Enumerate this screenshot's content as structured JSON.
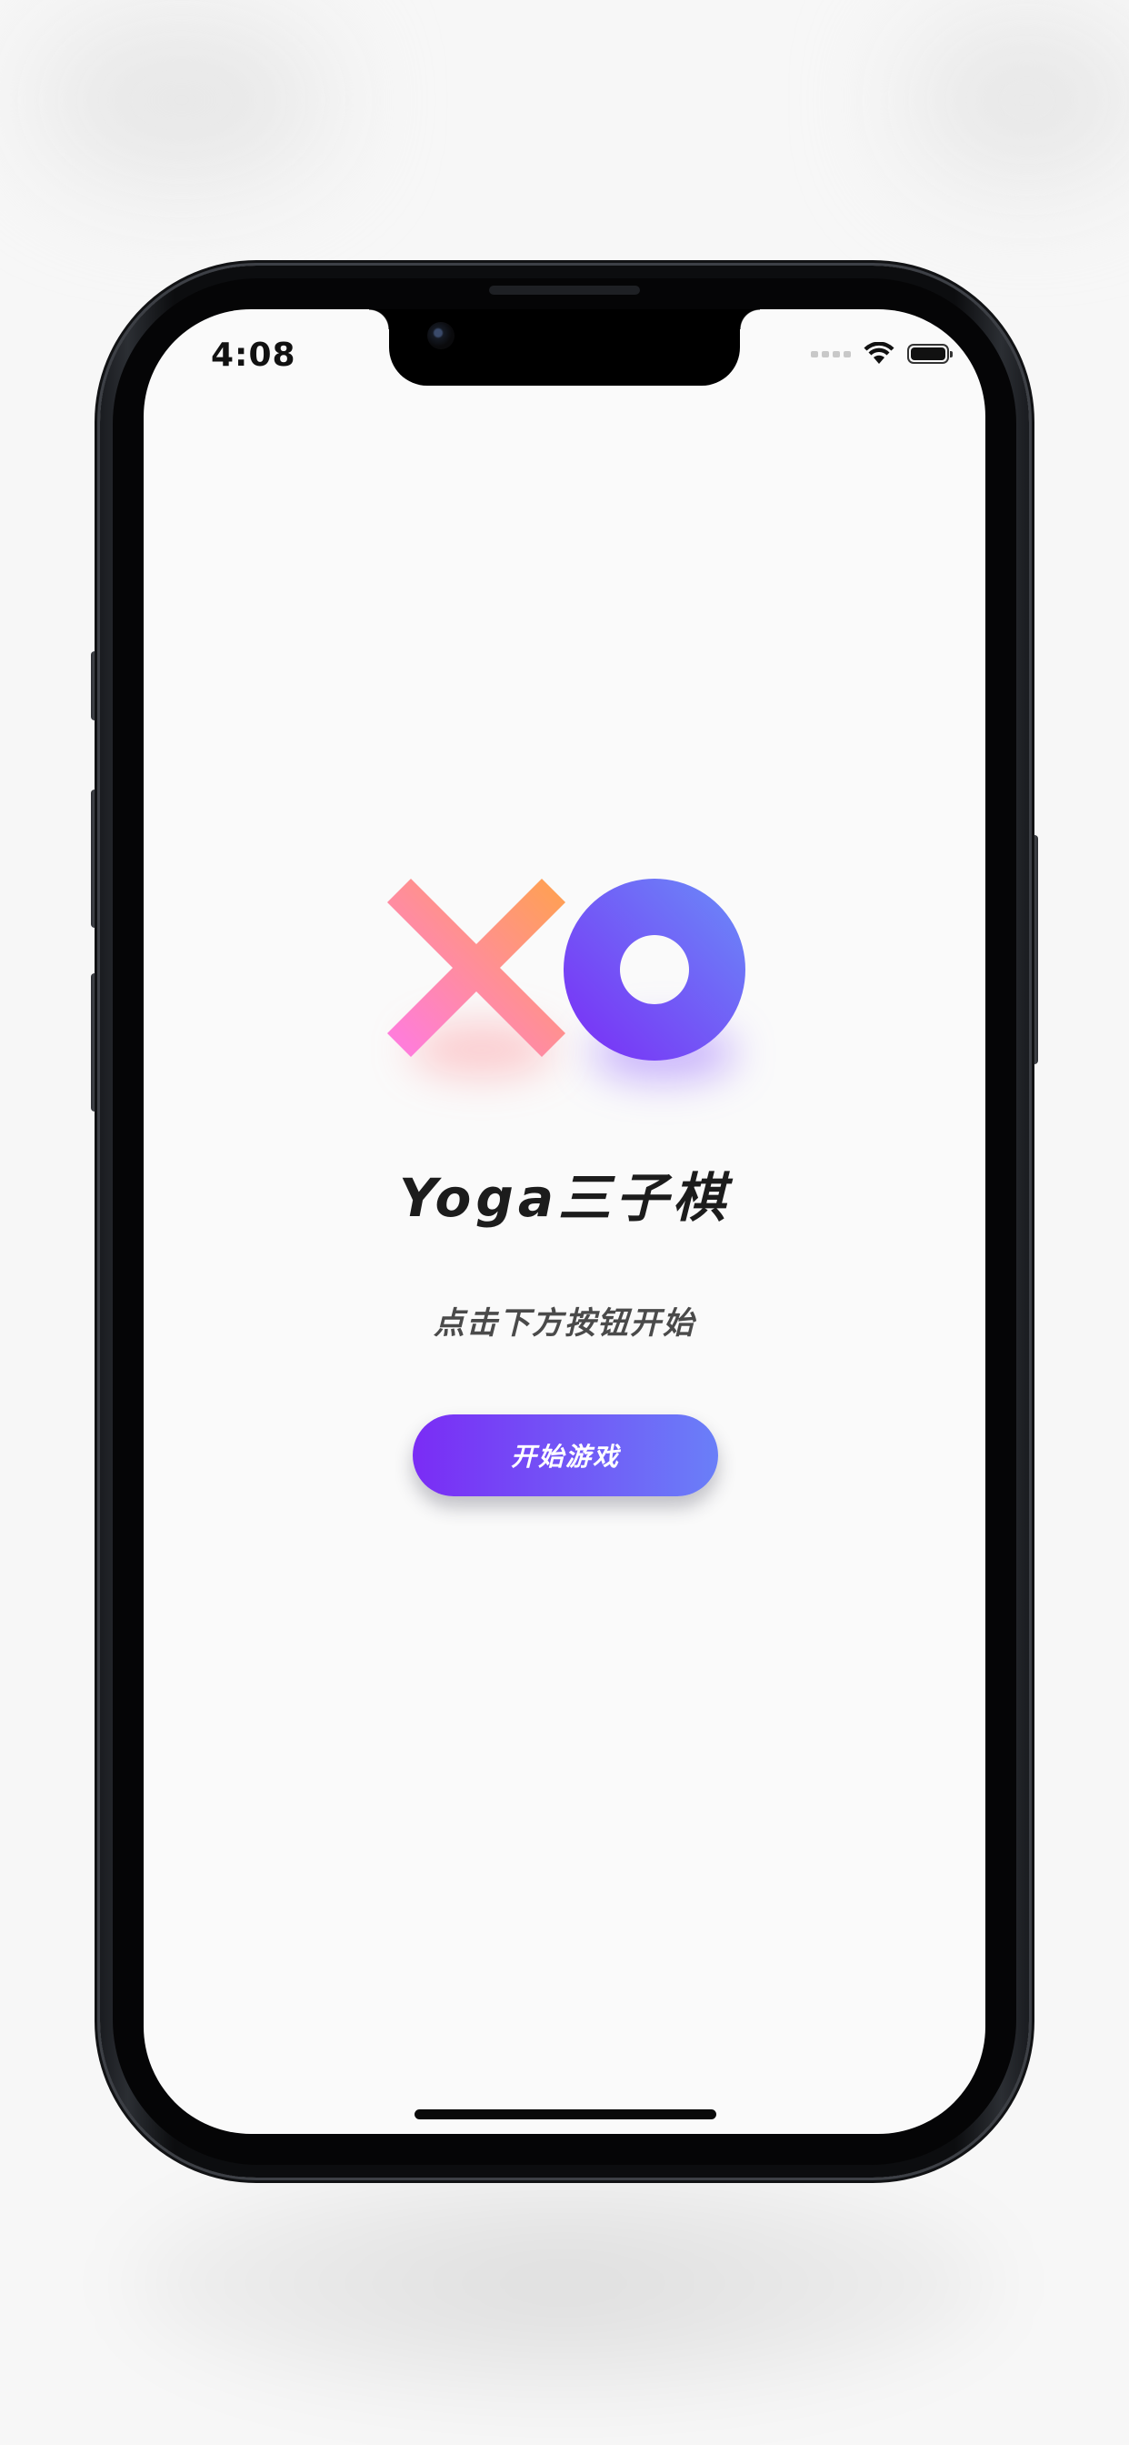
{
  "status_bar": {
    "time": "4:08"
  },
  "logo": {
    "x_icon": "x-mark-icon",
    "o_icon": "o-ring-icon"
  },
  "app": {
    "title": "Yoga三子棋",
    "subtitle": "点击下方按钮开始"
  },
  "actions": {
    "start_label": "开始游戏"
  },
  "colors": {
    "button_gradient_start": "#7a2cf5",
    "button_gradient_end": "#6a7ff8",
    "x_gradient_start": "#ff7ae5",
    "x_gradient_end": "#ffa24d",
    "o_gradient_start": "#7a2cf5",
    "o_gradient_end": "#6a8cf8",
    "title_color": "#1c1c1c",
    "subtitle_color": "#4a4a4a",
    "background": "#fafafa"
  }
}
